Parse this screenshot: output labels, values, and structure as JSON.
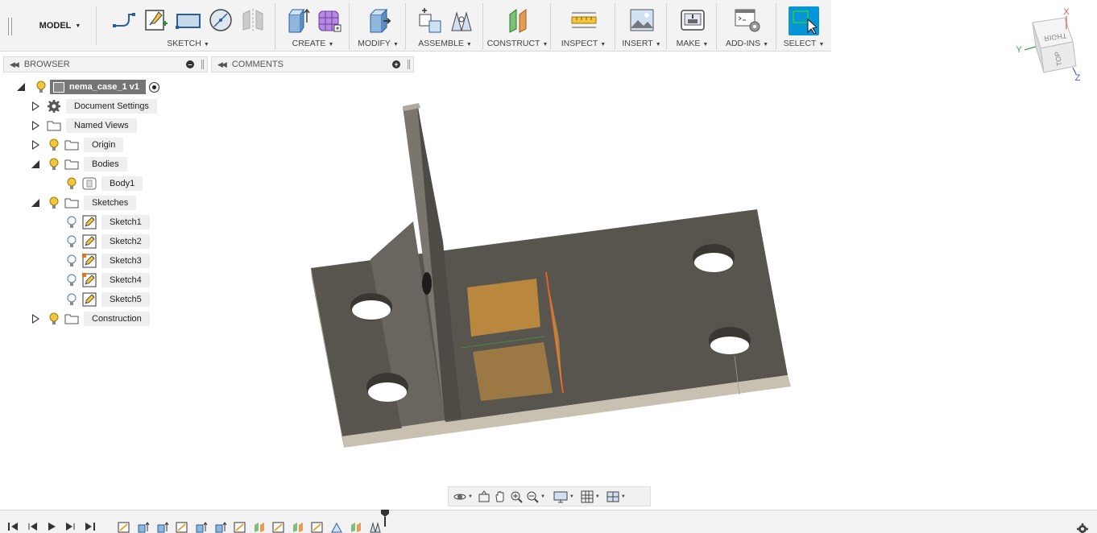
{
  "toolbar": {
    "workspace": "MODEL",
    "groups": [
      {
        "label": "SKETCH"
      },
      {
        "label": "CREATE"
      },
      {
        "label": "MODIFY"
      },
      {
        "label": "ASSEMBLE"
      },
      {
        "label": "CONSTRUCT"
      },
      {
        "label": "INSPECT"
      },
      {
        "label": "INSERT"
      },
      {
        "label": "MAKE"
      },
      {
        "label": "ADD-INS"
      },
      {
        "label": "SELECT"
      }
    ]
  },
  "browser": {
    "title": "BROWSER",
    "root": "nema_case_1 v1",
    "items": [
      {
        "label": "Document Settings"
      },
      {
        "label": "Named Views"
      },
      {
        "label": "Origin"
      },
      {
        "label": "Bodies"
      },
      {
        "label": "Body1"
      },
      {
        "label": "Sketches"
      },
      {
        "label": "Sketch1"
      },
      {
        "label": "Sketch2"
      },
      {
        "label": "Sketch3"
      },
      {
        "label": "Sketch4"
      },
      {
        "label": "Sketch5"
      },
      {
        "label": "Construction"
      }
    ]
  },
  "comments": {
    "title": "COMMENTS"
  },
  "viewcube": {
    "top_label": "RIGHT",
    "side_label": "TOP",
    "axis_x": "X",
    "axis_y": "Y",
    "axis_z": "Z"
  },
  "colors": {
    "accent": "#0696d7",
    "body": "#5a5650",
    "body_edge": "#c8c1b2",
    "sketch": "#e8a33a"
  }
}
